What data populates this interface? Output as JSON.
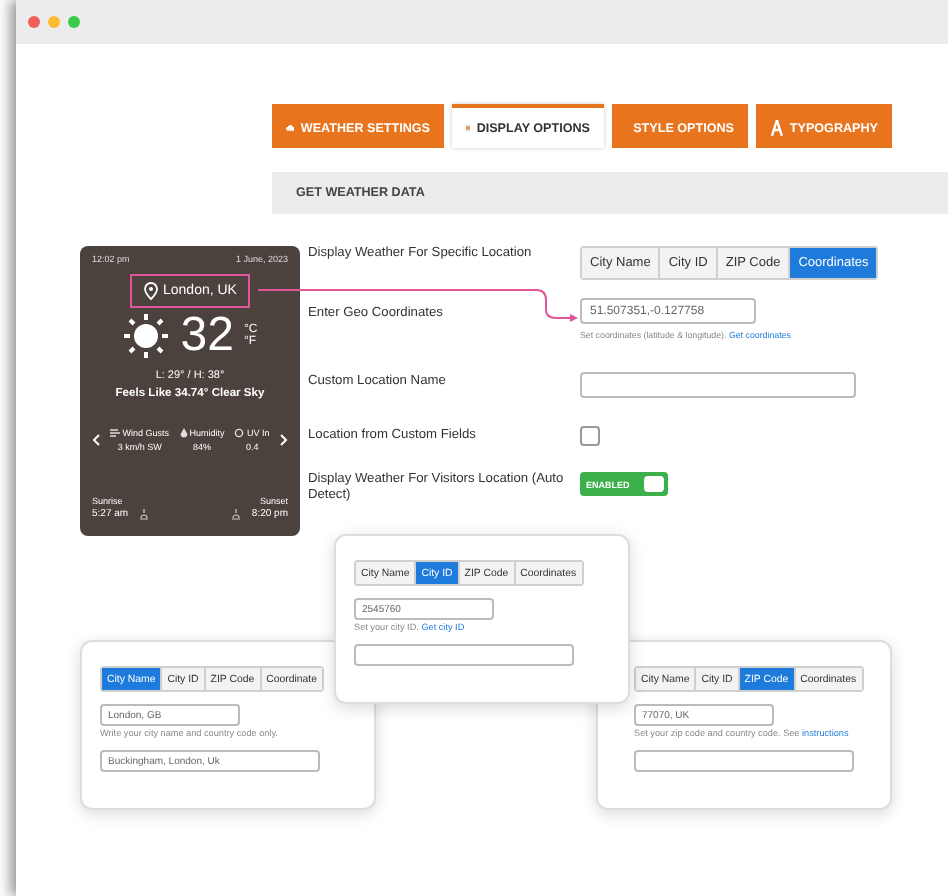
{
  "tabs": [
    {
      "label": "WEATHER SETTINGS",
      "selected": false
    },
    {
      "label": "DISPLAY OPTIONS",
      "selected": true
    },
    {
      "label": "STYLE OPTIONS",
      "selected": false
    },
    {
      "label": "TYPOGRAPHY",
      "selected": false
    }
  ],
  "section_title": "GET WEATHER DATA",
  "weather_card": {
    "time": "12:02 pm",
    "date": "1 June, 2023",
    "location": "London, UK",
    "temperature": "32",
    "unit_c": "°C",
    "unit_f": "°F",
    "low_high": "L: 29° / H: 38°",
    "feels_like": "Feels Like 34.74° Clear Sky",
    "stats": [
      {
        "label": "Wind Gusts",
        "value": "3 km/h SW"
      },
      {
        "label": "Humidity",
        "value": "84%"
      },
      {
        "label": "UV In",
        "value": "0.4"
      }
    ],
    "sunrise": {
      "label": "Sunrise",
      "time": "5:27 am"
    },
    "sunset": {
      "label": "Sunset",
      "time": "8:20 pm"
    }
  },
  "settings": [
    {
      "kind": "segmented",
      "label": "Display Weather For Specific Location",
      "options": [
        {
          "label": "City Name",
          "selected": false
        },
        {
          "label": "City ID",
          "selected": false
        },
        {
          "label": "ZIP Code",
          "selected": false
        },
        {
          "label": "Coordinates",
          "selected": true
        }
      ]
    },
    {
      "kind": "text",
      "label": "Enter Geo Coordinates",
      "value": "51.507351,-0.127758",
      "help": "Set coordinates (latitude & longitude).",
      "help_link": "Get coordinates"
    },
    {
      "kind": "text",
      "label": "Custom Location Name"
    },
    {
      "kind": "checkbox",
      "label": "Location from Custom Fields",
      "checked": false
    },
    {
      "kind": "toggle",
      "label": "Display Weather For Visitors Location (Auto Detect)",
      "on": true,
      "state_label": "ENABLED"
    }
  ],
  "popups": [
    {
      "options": [
        {
          "label": "City Name",
          "selected": false
        },
        {
          "label": "City ID",
          "selected": true
        },
        {
          "label": "ZIP Code",
          "selected": false
        },
        {
          "label": "Coordinates",
          "selected": false
        }
      ],
      "value": "2545760",
      "help": "Set your city ID.",
      "help_link": "Get city ID"
    },
    {
      "options": [
        {
          "label": "City Name",
          "selected": true
        },
        {
          "label": "City ID",
          "selected": false
        },
        {
          "label": "ZIP Code",
          "selected": false
        },
        {
          "label": "Coordinate",
          "selected": false
        }
      ],
      "value": "London, GB",
      "help": "Write your city name and country code only.",
      "second_value": "Buckingham, London, Uk"
    },
    {
      "options": [
        {
          "label": "City Name",
          "selected": false
        },
        {
          "label": "City ID",
          "selected": false
        },
        {
          "label": "ZIP Code",
          "selected": true
        },
        {
          "label": "Coordinates",
          "selected": false
        }
      ],
      "value": "77070, UK",
      "help": "Set your zip code and country code. See",
      "help_link": "instructions"
    }
  ]
}
